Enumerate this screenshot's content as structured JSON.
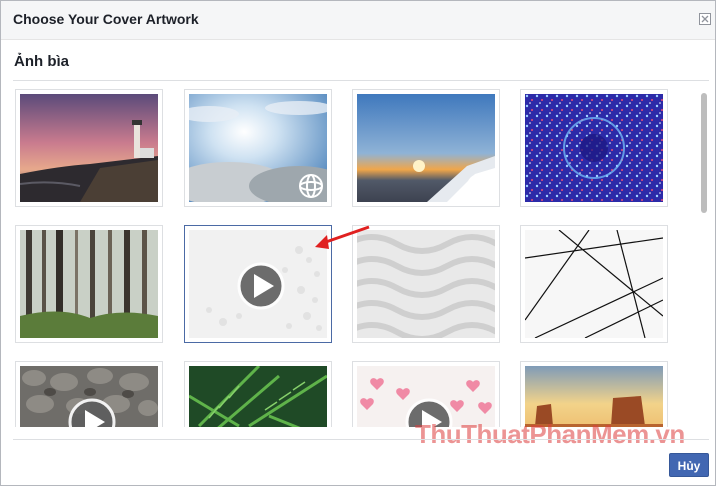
{
  "dialog": {
    "title": "Choose Your Cover Artwork",
    "section_title": "Ảnh bìa",
    "cancel_label": "Hủy"
  },
  "tiles": [
    {
      "subject": "lighthouse-sunset-photo",
      "kind": "photo"
    },
    {
      "subject": "clouds-sky-360-photo",
      "kind": "360"
    },
    {
      "subject": "sunset-over-clouds-360-photo",
      "kind": "360"
    },
    {
      "subject": "blue-kaleidoscope-pattern",
      "kind": "photo"
    },
    {
      "subject": "misty-forest-photo",
      "kind": "photo"
    },
    {
      "subject": "white-bubbles-video",
      "kind": "video",
      "selected": true
    },
    {
      "subject": "white-waves-pattern",
      "kind": "photo"
    },
    {
      "subject": "black-lines-pattern",
      "kind": "photo"
    },
    {
      "subject": "rocks-video",
      "kind": "video"
    },
    {
      "subject": "fern-leaves-photo",
      "kind": "photo"
    },
    {
      "subject": "pink-hearts-video",
      "kind": "video"
    },
    {
      "subject": "desert-rocks-photo",
      "kind": "photo"
    }
  ],
  "watermark": "ThuThuatPhanMem.vn",
  "colors": {
    "button": "#4267b2",
    "header_bg": "#f5f6f7",
    "selected_border": "#4b6aa5",
    "annotation_arrow": "#e02020"
  }
}
